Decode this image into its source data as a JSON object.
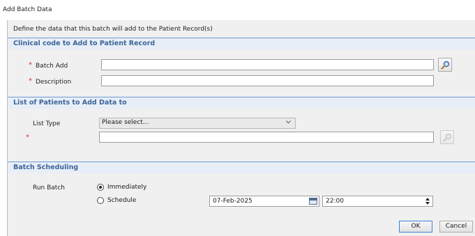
{
  "window": {
    "title": "Add Batch Data"
  },
  "description": "Define the data that this batch will add to the Patient Record(s)",
  "sections": {
    "clinical": {
      "title": "Clinical code to Add to Patient Record",
      "batch_add_label": "Batch Add",
      "batch_add_value": "",
      "description_label": "Description",
      "description_value": "",
      "required_mark": "*"
    },
    "patients": {
      "title": "List of Patients to Add Data to",
      "list_type_label": "List Type",
      "list_type_selected": "Please select...",
      "list_value": "",
      "required_mark": "*"
    },
    "scheduling": {
      "title": "Batch Scheduling",
      "run_batch_label": "Run Batch",
      "option_immediately": "Immediately",
      "option_schedule": "Schedule",
      "selected": "Immediately",
      "date_value": "07-Feb-2025",
      "time_value": "22:00"
    }
  },
  "buttons": {
    "ok": "OK",
    "cancel": "Cancel"
  },
  "colors": {
    "section_title": "#3d6599",
    "section_border": "#6c9bd6",
    "required": "#d83030",
    "panel_bg": "#f0f0f0"
  },
  "icons": {
    "search": "magnifier-icon",
    "calendar": "calendar-icon",
    "chevron": "chevron-down-icon"
  }
}
